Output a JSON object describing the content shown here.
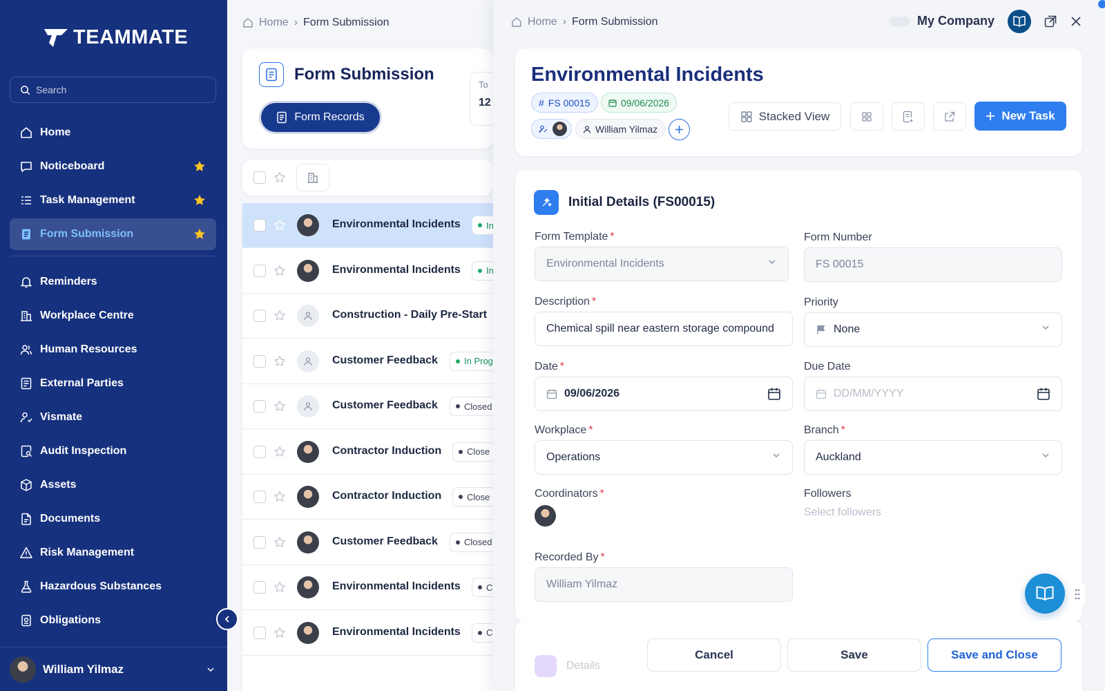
{
  "sidebar": {
    "logo_text": "TEAMMATE",
    "search_placeholder": "Search",
    "items": [
      {
        "label": "Home",
        "icon": "home-icon",
        "starred": false,
        "active": false
      },
      {
        "label": "Noticeboard",
        "icon": "message-icon",
        "starred": true,
        "active": false
      },
      {
        "label": "Task Management",
        "icon": "task-list-icon",
        "starred": true,
        "active": false
      },
      {
        "label": "Form Submission",
        "icon": "form-icon",
        "starred": true,
        "active": true
      }
    ],
    "items2": [
      {
        "label": "Reminders",
        "icon": "bell-icon"
      },
      {
        "label": "Workplace Centre",
        "icon": "building-icon"
      },
      {
        "label": "Human Resources",
        "icon": "people-icon"
      },
      {
        "label": "External Parties",
        "icon": "contacts-icon"
      },
      {
        "label": "Vismate",
        "icon": "visitor-icon"
      },
      {
        "label": "Audit Inspection",
        "icon": "audit-icon"
      },
      {
        "label": "Assets",
        "icon": "box-icon"
      },
      {
        "label": "Documents",
        "icon": "document-icon"
      },
      {
        "label": "Risk Management",
        "icon": "warning-icon"
      },
      {
        "label": "Hazardous Substances",
        "icon": "flask-icon"
      },
      {
        "label": "Obligations",
        "icon": "obligation-icon"
      }
    ],
    "user_name": "William Yilmaz",
    "accent_star_color": "#f7c325"
  },
  "list": {
    "breadcrumb": {
      "home": "Home",
      "current": "Form Submission"
    },
    "title": "Form Submission",
    "records_button": "Form Records",
    "stat_label": "To",
    "stat_value": "12",
    "rows": [
      {
        "title": "Environmental Incidents",
        "status": "In",
        "status_type": "progress",
        "avatar": "photo",
        "selected": true
      },
      {
        "title": "Environmental Incidents",
        "status": "In",
        "status_type": "progress",
        "avatar": "photo",
        "selected": false
      },
      {
        "title": "Construction - Daily Pre-Start",
        "status": "",
        "status_type": "none",
        "avatar": "placeholder",
        "selected": false
      },
      {
        "title": "Customer Feedback",
        "status": "In Prog",
        "status_type": "progress",
        "avatar": "placeholder",
        "selected": false
      },
      {
        "title": "Customer Feedback",
        "status": "Closed",
        "status_type": "closed",
        "avatar": "placeholder",
        "selected": false
      },
      {
        "title": "Contractor Induction",
        "status": "Close",
        "status_type": "closed",
        "avatar": "photo",
        "selected": false
      },
      {
        "title": "Contractor Induction",
        "status": "Close",
        "status_type": "closed",
        "avatar": "photo",
        "selected": false
      },
      {
        "title": "Customer Feedback",
        "status": "Closed",
        "status_type": "closed",
        "avatar": "photo",
        "selected": false
      },
      {
        "title": "Environmental Incidents",
        "status": "Cl",
        "status_type": "closed",
        "avatar": "photo",
        "selected": false
      },
      {
        "title": "Environmental Incidents",
        "status": "Cl",
        "status_type": "closed",
        "avatar": "photo",
        "selected": false
      }
    ]
  },
  "detail": {
    "breadcrumb": {
      "home": "Home",
      "current": "Form Submission"
    },
    "company": "My Company",
    "title": "Environmental Incidents",
    "form_id": "FS 00015",
    "date_chip": "09/06/2026",
    "assignee": "William Yilmaz",
    "stacked_view": "Stacked View",
    "new_task": "New Task",
    "section_title": "Initial Details (FS00015)",
    "fields": {
      "form_template": {
        "label": "Form Template",
        "value": "Environmental Incidents",
        "required": true
      },
      "form_number": {
        "label": "Form Number",
        "value": "FS 00015"
      },
      "description": {
        "label": "Description",
        "value": "Chemical spill near eastern storage compound",
        "required": true
      },
      "priority": {
        "label": "Priority",
        "value": "None"
      },
      "date": {
        "label": "Date",
        "value": "09/06/2026",
        "required": true
      },
      "due_date": {
        "label": "Due Date",
        "placeholder": "DD/MM/YYYY"
      },
      "workplace": {
        "label": "Workplace",
        "value": "Operations",
        "required": true
      },
      "branch": {
        "label": "Branch",
        "value": "Auckland",
        "required": true
      },
      "coordinators": {
        "label": "Coordinators",
        "required": true
      },
      "followers": {
        "label": "Followers",
        "placeholder": "Select followers"
      },
      "recorded_by": {
        "label": "Recorded By",
        "value": "William Yilmaz",
        "required": true
      }
    },
    "ghost_tab": "Details",
    "buttons": {
      "cancel": "Cancel",
      "save": "Save",
      "save_close": "Save and Close"
    }
  }
}
